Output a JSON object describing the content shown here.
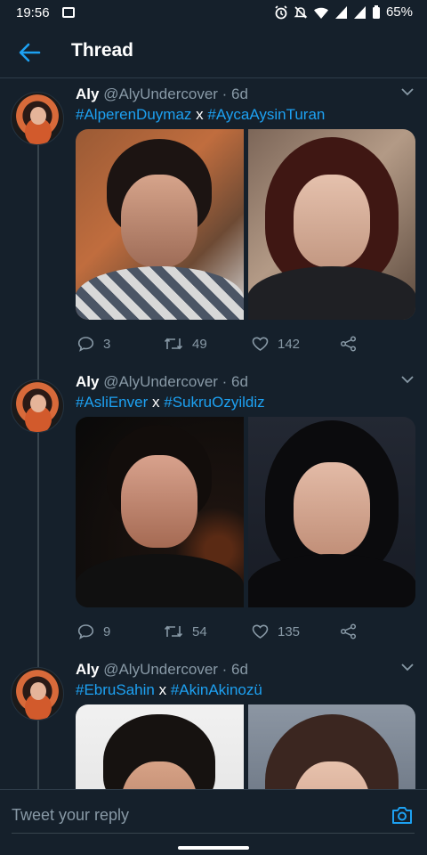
{
  "status_bar": {
    "time": "19:56",
    "battery": "65%",
    "icons": [
      "image-notification-icon",
      "alarm-icon",
      "silent-bell-icon",
      "wifi-icon",
      "signal-icon",
      "signal-icon",
      "battery-icon"
    ]
  },
  "header": {
    "title": "Thread",
    "back_icon": "back-arrow-icon",
    "accent": "#1da1f2"
  },
  "tweets": [
    {
      "author": "Aly",
      "handle_time": "@AlyUndercover · 6d",
      "hashtag_a": "#AlperenDuymaz",
      "separator": "x",
      "hashtag_b": "#AycaAysinTuran",
      "replies": "3",
      "retweets": "49",
      "likes": "142"
    },
    {
      "author": "Aly",
      "handle_time": "@AlyUndercover · 6d",
      "hashtag_a": "#AsliEnver",
      "separator": "x",
      "hashtag_b": "#SukruOzyildiz",
      "replies": "9",
      "retweets": "54",
      "likes": "135"
    },
    {
      "author": "Aly",
      "handle_time": "@AlyUndercover · 6d",
      "hashtag_a": "#EbruSahin",
      "separator": "x",
      "hashtag_b": "#AkinAkinozü"
    }
  ],
  "reply_bar": {
    "placeholder": "Tweet your reply",
    "camera_icon": "camera-icon"
  },
  "colors": {
    "background": "#15202b",
    "muted_text": "#8899a6",
    "divider": "#2f3d4a"
  }
}
